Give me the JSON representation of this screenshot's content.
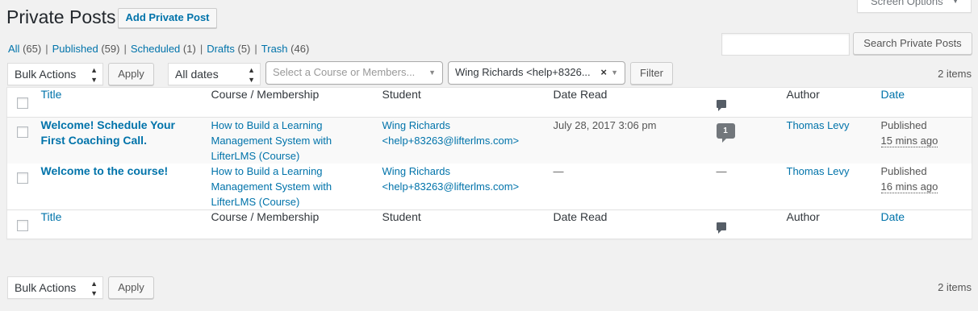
{
  "screen_options": {
    "label": "Screen Options"
  },
  "header": {
    "title": "Private Posts",
    "add_new": "Add Private Post"
  },
  "views": [
    {
      "label": "All",
      "count": "(65)"
    },
    {
      "label": "Published",
      "count": "(59)"
    },
    {
      "label": "Scheduled",
      "count": "(1)"
    },
    {
      "label": "Drafts",
      "count": "(5)"
    },
    {
      "label": "Trash",
      "count": "(46)"
    }
  ],
  "search": {
    "value": "",
    "button": "Search Private Posts"
  },
  "top_nav": {
    "bulk_actions": "Bulk Actions",
    "apply": "Apply",
    "dates": "All dates",
    "course_placeholder": "Select a Course or Members...",
    "student_selected": "Wing Richards <help+8326...",
    "clear": "×",
    "filter": "Filter",
    "items": "2 items"
  },
  "bottom_nav": {
    "bulk_actions": "Bulk Actions",
    "apply": "Apply",
    "items": "2 items"
  },
  "columns": {
    "title": "Title",
    "course": "Course / Membership",
    "student": "Student",
    "date_read": "Date Read",
    "author": "Author",
    "date": "Date"
  },
  "rows": [
    {
      "title": "Welcome! Schedule Your First Coaching Call.",
      "course_line1": "How to Build a Learning",
      "course_line2": "Management System with",
      "course_line3": "LifterLMS (Course)",
      "student_name": "Wing Richards",
      "student_email": "<help+83263@lifterlms.com>",
      "date_read": "July 28, 2017 3:06 pm",
      "comments": "1",
      "author": "Thomas Levy",
      "status": "Published",
      "ago": "15 mins ago"
    },
    {
      "title": "Welcome to the course!",
      "course_line1": "How to Build a Learning",
      "course_line2": "Management System with",
      "course_line3": "LifterLMS (Course)",
      "student_name": "Wing Richards",
      "student_email": "<help+83263@lifterlms.com>",
      "date_read": "—",
      "comments": "—",
      "author": "Thomas Levy",
      "status": "Published",
      "ago": "16 mins ago"
    }
  ],
  "colors": {
    "link": "#0073aa",
    "background": "#f1f1f1"
  },
  "icons": {
    "comments_header": "comment-icon",
    "comment_count": "comment-count-bubble",
    "select_arrows": "up-down-arrows-icon"
  }
}
